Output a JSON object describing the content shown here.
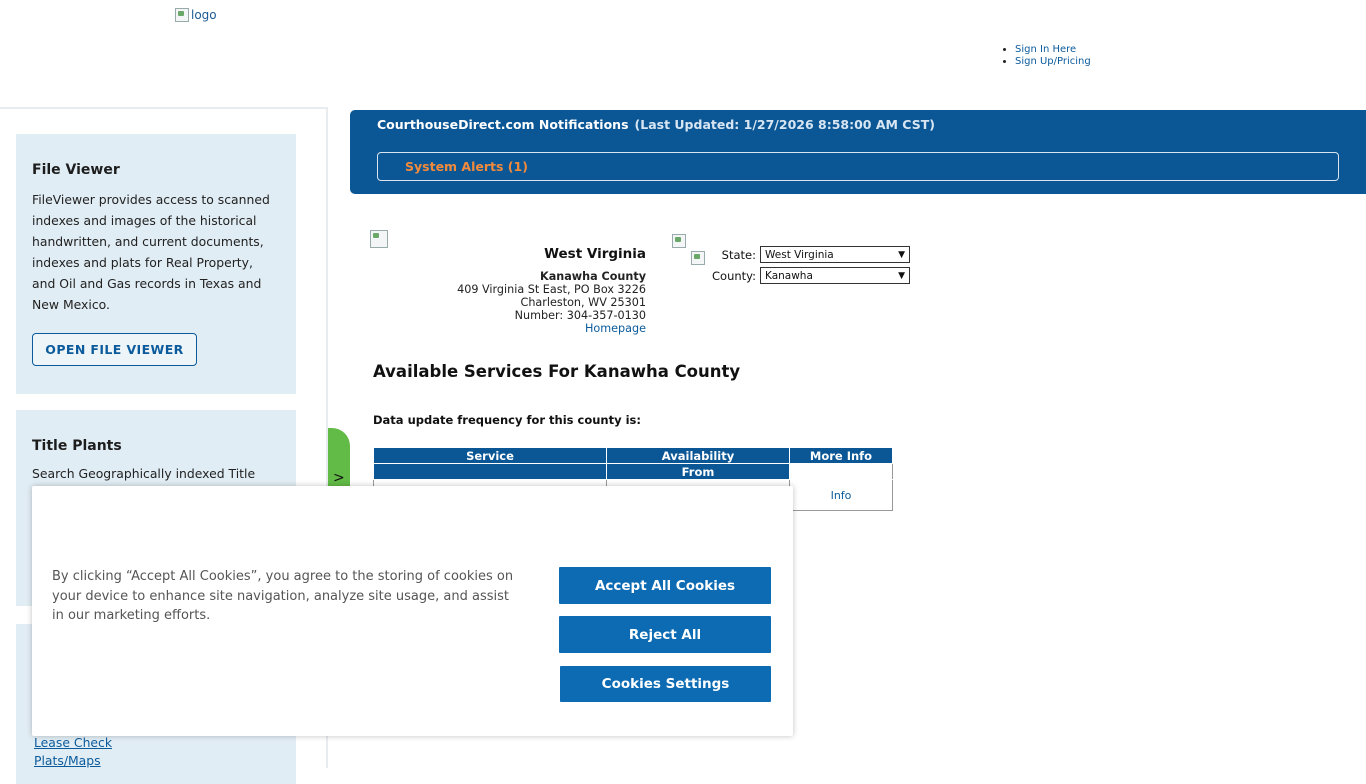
{
  "header": {
    "logo_alt": "logo",
    "links": [
      "Sign In Here",
      "Sign Up/Pricing"
    ]
  },
  "sidebar": {
    "file_viewer": {
      "title": "File Viewer",
      "text": "FileViewer provides access to scanned indexes and images of the historical handwritten, and current documents, indexes and plats for Real Property, and Oil and Gas records in Texas and New Mexico.",
      "button": "OPEN FILE VIEWER"
    },
    "title_plants": {
      "title": "Title Plants",
      "text": "Search Geographically indexed Title"
    },
    "links": [
      "Lease Check",
      "Plats/Maps"
    ],
    "tab_arrow": ">"
  },
  "notifications": {
    "title": "CourthouseDirect.com Notifications",
    "last_updated": "(Last Updated: 1/27/2026 8:58:00 AM CST)",
    "alerts": "System Alerts (1)"
  },
  "county": {
    "state_name": "West Virginia",
    "county_name": "Kanawha County",
    "address1": "409 Virginia St East, PO Box 3226",
    "address2": "Charleston, WV 25301",
    "number": "Number: 304-357-0130",
    "homepage": "Homepage"
  },
  "selectors": {
    "state_label": "State:",
    "state_value": "West Virginia",
    "county_label": "County:",
    "county_value": "Kanawha"
  },
  "services": {
    "title": "Available Services For Kanawha County",
    "frequency": "Data update frequency for this county is:",
    "columns": [
      "Service",
      "Availability",
      "More Info"
    ],
    "sub_column": "From",
    "row_info": "Info"
  },
  "cookie": {
    "text": "By clicking “Accept All Cookies”, you agree to the storing of cookies on your device to enhance site navigation, analyze site usage, and assist in our marketing efforts.",
    "accept": "Accept All Cookies",
    "reject": "Reject All",
    "settings": "Cookies Settings"
  },
  "colors": {
    "brand_blue": "#0b5796",
    "alert_orange": "#f28a3c",
    "green_tab": "#62bb46",
    "card_bg": "#e1edf4"
  }
}
